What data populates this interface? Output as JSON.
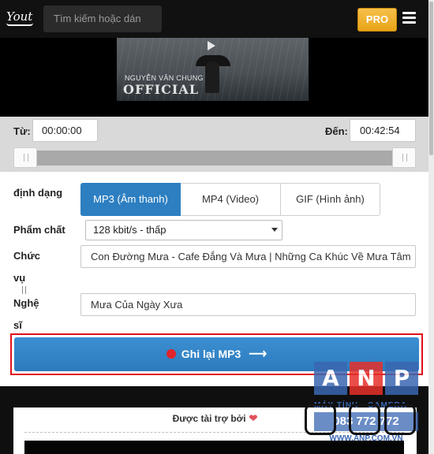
{
  "header": {
    "logo_text": "Yout",
    "search_placeholder": "Tìm kiếm hoặc dán",
    "pro_label": "PRO",
    "menu_icon": "hamburger-menu-icon"
  },
  "video": {
    "artist_overlay": "NGUYỄN VĂN CHUNG",
    "official_overlay": "OFFICIAL"
  },
  "trim": {
    "from_label": "Từ:",
    "from_value": "00:00:00",
    "to_label": "Đến:",
    "to_value": "00:42:54"
  },
  "form": {
    "format_label": "định dạng",
    "formats": [
      "MP3 (Âm thanh)",
      "MP4 (Video)",
      "GIF (Hình ảnh)"
    ],
    "active_format": "MP3 (Âm thanh)",
    "quality_label": "Phẩm chất",
    "quality_value": "128 kbit/s - thấp",
    "title_label_line1": "Chức",
    "title_label_line2": "vụ",
    "title_value": "Con Đường Mưa  -  Cafe Đắng Và Mưa | Những Ca Khúc Về Mưa Tâm",
    "artist_label_line1": "Nghệ",
    "artist_label_line2": "sĩ",
    "artist_value": "Mưa Của Ngày Xưa",
    "record_label": "Ghi lại MP3",
    "record_arrow": "⟶"
  },
  "sponsor": {
    "text": "Được tài trợ bởi",
    "heart": "❤"
  },
  "watermark": {
    "letters": [
      "A",
      "N",
      "P"
    ],
    "subtitle": "MÁY TÍNH - CAMERA",
    "phone": "083 772 772",
    "site": "WWW.ANP.COM.VN"
  },
  "colors": {
    "accent_blue": "#2d7fc1",
    "pro_gold": "#f0b030",
    "record_red": "#e3232b",
    "highlight_border": "#e0101a"
  }
}
